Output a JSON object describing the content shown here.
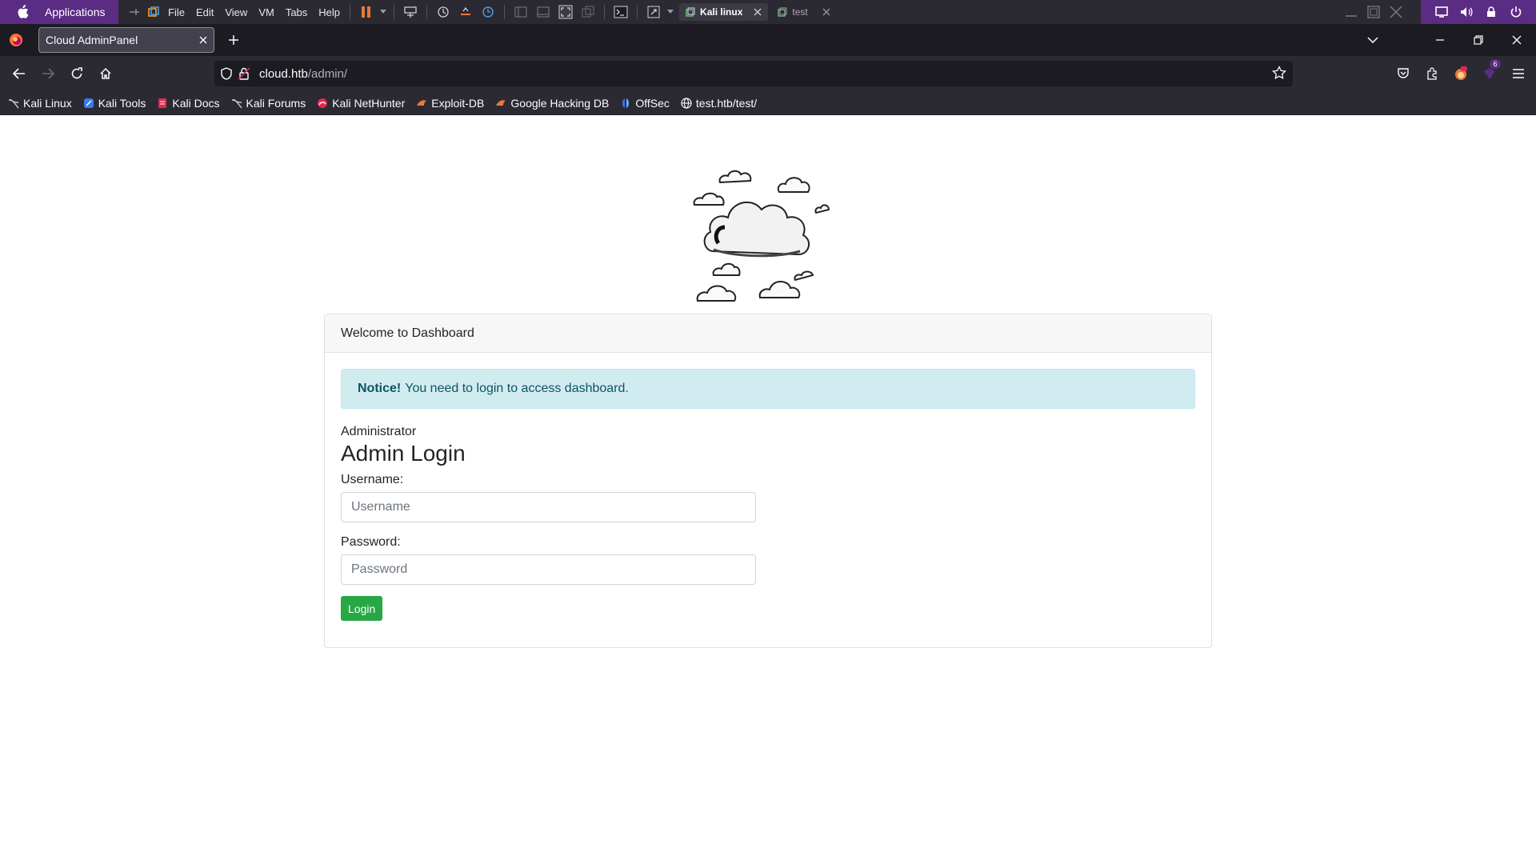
{
  "vm": {
    "applications_label": "Applications",
    "menu": [
      "File",
      "Edit",
      "View",
      "VM",
      "Tabs",
      "Help"
    ],
    "tabs": [
      {
        "label": "Kali linux",
        "active": true
      },
      {
        "label": "test",
        "active": false
      }
    ]
  },
  "browser": {
    "tab_title": "Cloud AdminPanel",
    "url_host": "cloud.htb",
    "url_path": "/admin/",
    "extension_badge": "6",
    "bookmarks": [
      {
        "label": "Kali Linux",
        "icon": "kali-dragon-icon"
      },
      {
        "label": "Kali Tools",
        "icon": "kali-tools-icon"
      },
      {
        "label": "Kali Docs",
        "icon": "kali-docs-icon"
      },
      {
        "label": "Kali Forums",
        "icon": "kali-dragon-icon"
      },
      {
        "label": "Kali NetHunter",
        "icon": "nethunter-icon"
      },
      {
        "label": "Exploit-DB",
        "icon": "exploit-db-icon"
      },
      {
        "label": "Google Hacking DB",
        "icon": "exploit-db-icon"
      },
      {
        "label": "OffSec",
        "icon": "offsec-icon"
      },
      {
        "label": "test.htb/test/",
        "icon": "globe-icon"
      }
    ]
  },
  "page": {
    "card_header": "Welcome to Dashboard",
    "alert_strong": "Notice!",
    "alert_text": "You need to login to access dashboard.",
    "subtitle": "Administrator",
    "title": "Admin Login",
    "username_label": "Username:",
    "username_placeholder": "Username",
    "password_label": "Password:",
    "password_placeholder": "Password",
    "login_button": "Login"
  },
  "colors": {
    "vm_purple": "#5b2c83",
    "alert_bg": "#d1ecf1",
    "alert_text": "#0c5460",
    "login_green": "#28a745"
  }
}
